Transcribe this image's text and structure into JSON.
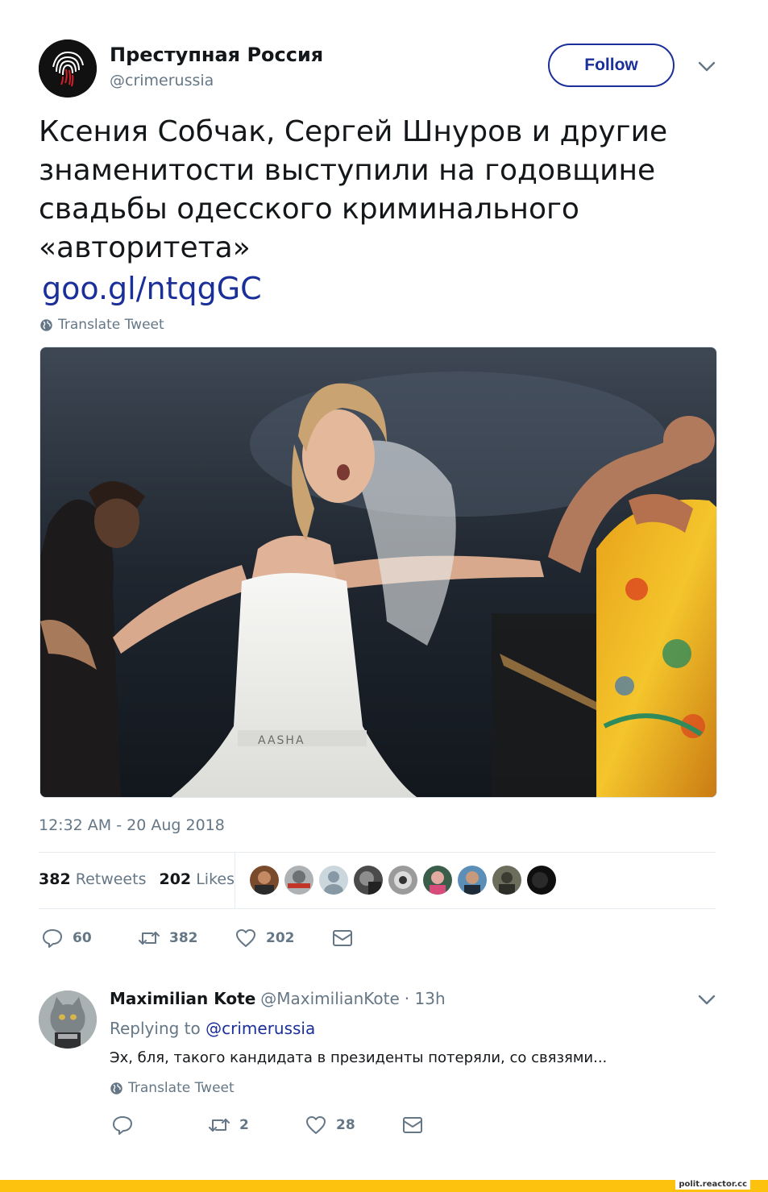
{
  "author": {
    "name": "Преступная Россия",
    "handle": "@crimerussia"
  },
  "follow_label": "Follow",
  "tweet": {
    "text": "Ксения Собчак, Сергей Шнуров и другие знаменитости выступили на годовщине свадьбы одесского криминального «авторитета»",
    "link": "goo.gl/ntqgGC",
    "translate_label": "Translate Tweet",
    "timestamp": "12:32 AM - 20 Aug 2018",
    "media_caption": "AASHA"
  },
  "stats": {
    "retweets_count": "382",
    "retweets_label": "Retweets",
    "likes_count": "202",
    "likes_label": "Likes"
  },
  "actions": {
    "replies": "60",
    "retweets": "382",
    "likes": "202"
  },
  "reply": {
    "name": "Maximilian Kote",
    "handle": "@MaximilianKote",
    "time": "· 13h",
    "replying_prefix": "Replying to",
    "replying_to": "@crimerussia",
    "text": "Эх, бля, такого кандидата в президенты потеряли, со связями...",
    "translate_label": "Translate Tweet",
    "actions": {
      "replies": "",
      "retweets": "2",
      "likes": "28"
    }
  },
  "footer": {
    "site": "polit.reactor.cc"
  },
  "colors": {
    "link": "#1b2f9a",
    "muted": "#657786",
    "footer_bar": "#fdc20e"
  }
}
